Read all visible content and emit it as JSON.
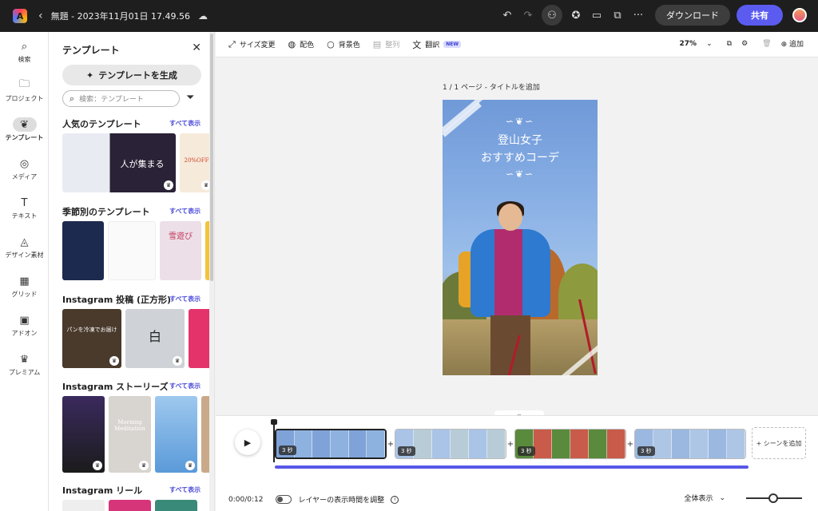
{
  "topbar": {
    "logo_icon": "adobe-express-logo",
    "doc_title": "無題 - 2023年11月01日 17.49.56",
    "download_label": "ダウンロード",
    "share_label": "共有"
  },
  "rail": {
    "items": [
      {
        "label": "検索",
        "icon": "⌕"
      },
      {
        "label": "プロジェクト",
        "icon": "🗀"
      },
      {
        "label": "テンプレート",
        "icon": "❦"
      },
      {
        "label": "メディア",
        "icon": "◎"
      },
      {
        "label": "テキスト",
        "icon": "T"
      },
      {
        "label": "デザイン素材",
        "icon": "◬"
      },
      {
        "label": "グリッド",
        "icon": "▦"
      },
      {
        "label": "アドオン",
        "icon": "▣"
      },
      {
        "label": "プレミアム",
        "icon": "♛"
      }
    ]
  },
  "panel": {
    "title": "テンプレート",
    "generate_label": "テンプレートを生成",
    "search_placeholder": "検索：テンプレート",
    "see_all": "すべて表示",
    "sections": [
      {
        "title": "人気のテンプレート"
      },
      {
        "title": "季節別のテンプレート"
      },
      {
        "title": "Instagram 投稿 (正方形)"
      },
      {
        "title": "Instagram ストーリーズ"
      },
      {
        "title": "Instagram リール"
      }
    ],
    "thumb_text": {
      "popular_main": "人が集まる",
      "popular_side": "20%OFF",
      "season_snow": "雪遊び",
      "square_bread": "パンを冷凍でお届け",
      "square_shirt": "白",
      "story_meditation": "Morning Meditation"
    }
  },
  "toolbar": {
    "resize": "サイズ変更",
    "palette": "配色",
    "bg": "背景色",
    "align": "整列",
    "translate": "翻訳",
    "new_badge": "NEW",
    "zoom": "27%",
    "add": "追加"
  },
  "canvas": {
    "page_label": "1 / 1 ページ - タイトルを追加",
    "title_line1": "登山女子",
    "title_line2": "おすすめコーデ"
  },
  "timeline": {
    "scenes": [
      {
        "duration": "3 秒"
      },
      {
        "duration": "3 秒"
      },
      {
        "duration": "3 秒"
      },
      {
        "duration": "3 秒"
      }
    ],
    "add_scene": "+ シーンを追加",
    "time": "0:00/0:12",
    "layer_toggle_label": "レイヤーの表示時間を調整",
    "view_all": "全体表示",
    "zoom_level": 0.48
  }
}
